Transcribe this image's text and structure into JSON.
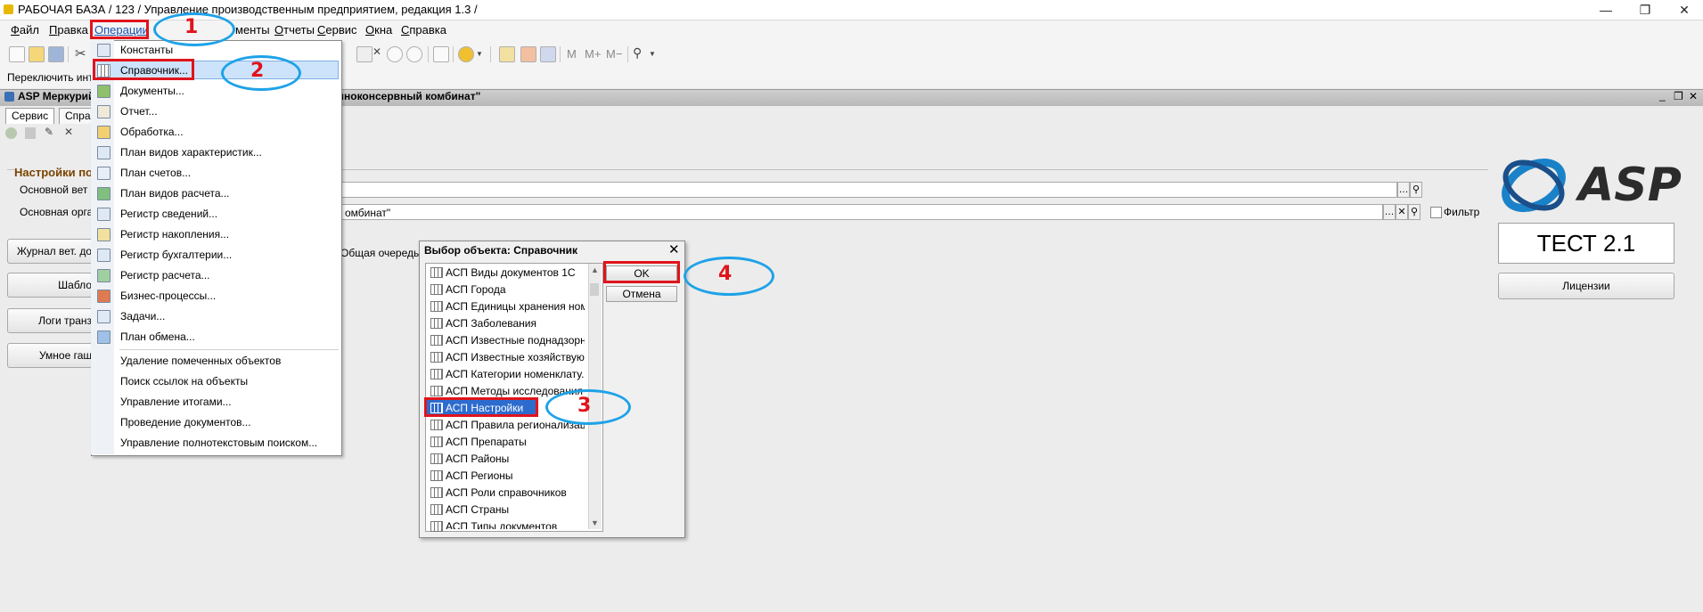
{
  "window": {
    "title": "РАБОЧАЯ БАЗА / 123 /  Управление производственным предприятием, редакция 1.3 /",
    "controls": [
      "―",
      "❐",
      "✕"
    ]
  },
  "menubar": {
    "items": [
      "Файл",
      "Правка",
      "Операции",
      "Документы",
      "Отчеты",
      "Сервис",
      "Окна",
      "Справка"
    ],
    "partial_documents": "менты"
  },
  "toolbar": {
    "m_buttons": [
      "M",
      "M+",
      "M−"
    ]
  },
  "switch_interface": {
    "label": "Переключить инте"
  },
  "document": {
    "title": "ASP Меркурий",
    "title_tail": "очноконсервный комбинат\"",
    "tabs": [
      "Сервис",
      "Справ"
    ],
    "controls": [
      "_",
      "❐",
      "✕"
    ]
  },
  "settings": {
    "group_title": "Настройки по",
    "vet_label": "Основной вет в",
    "org_label": "Основная орган",
    "org_value": "омбинат\"",
    "filter_label": "Фильтр",
    "queue_label": "Общая очередь",
    "buttons": [
      "Журнал вет. до",
      "Шабло",
      "Логи транз",
      "Умное гаш"
    ]
  },
  "operations_menu": {
    "items": [
      "Константы",
      "Справочник...",
      "Документы...",
      "Отчет...",
      "Обработка...",
      "План видов характеристик...",
      "План счетов...",
      "План видов расчета...",
      "Регистр сведений...",
      "Регистр накопления...",
      "Регистр бухгалтерии...",
      "Регистр расчета...",
      "Бизнес-процессы...",
      "Задачи...",
      "План обмена..."
    ],
    "service_items": [
      "Удаление помеченных объектов",
      "Поиск ссылок на объекты",
      "Управление итогами...",
      "Проведение документов...",
      "Управление полнотекстовым поиском..."
    ]
  },
  "dialog": {
    "title": "Выбор объекта: Справочник",
    "items": [
      "АСП Виды документов 1С",
      "АСП Города",
      "АСП Единицы хранения ном...",
      "АСП Заболевания",
      "АСП Известные поднадзорн...",
      "АСП Известные хозяйствую...",
      "АСП Категории номенклату...",
      "АСП Методы исследования",
      "АСП Настройки",
      "АСП Правила регионализац...",
      "АСП Препараты",
      "АСП Районы",
      "АСП Регионы",
      "АСП Роли справочников",
      "АСП Страны",
      "АСП Типы документов"
    ],
    "selected_index": 8,
    "ok_label": "OK",
    "cancel_label": "Отмена"
  },
  "brand": {
    "logo_text": "ASP",
    "test_label": "ТЕСТ 2.1",
    "license_button": "Лицензии"
  },
  "annotations": [
    "1",
    "2",
    "3",
    "4"
  ],
  "colors": {
    "annotation_box": "#e0141c",
    "annotation_ellipse": "#1ea2e8",
    "selection": "#2d6ccf",
    "group_title": "#7a4400"
  }
}
